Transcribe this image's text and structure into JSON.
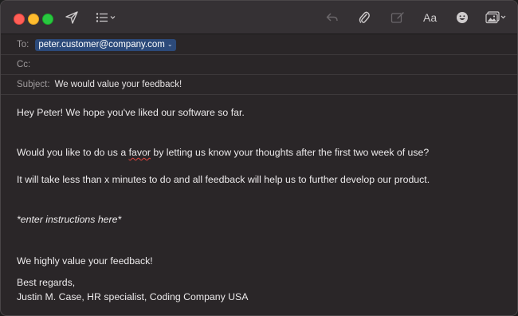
{
  "toolbar": {
    "icons": [
      "send-icon",
      "list-format-icon",
      "reply-icon",
      "attachment-icon",
      "markup-icon",
      "font-icon",
      "emoji-icon",
      "photo-browser-icon"
    ],
    "font_label": "Aa"
  },
  "header": {
    "to_label": "To:",
    "to_value": "peter.customer@company.com",
    "cc_label": "Cc:",
    "subject_label": "Subject:",
    "subject_value": "We would value your feedback!"
  },
  "body": {
    "greeting": "Hey Peter! We hope you've liked our software so far.",
    "favor_before": "Would you like to do us a ",
    "favor_word": "favor",
    "favor_after": " by letting us know your thoughts after the first two week of use?",
    "minutes_line": "It will take less than x minutes to do and all feedback will help us to further develop our product.",
    "instructions": "*enter instructions here*",
    "value_line": "We highly value your feedback!",
    "sign_off": "Best regards,",
    "signature": "Justin M. Case, HR specialist, Coding Company USA"
  },
  "colors": {
    "recipient_chip": "#2c4a7a",
    "spellcheck": "#e0443e"
  }
}
